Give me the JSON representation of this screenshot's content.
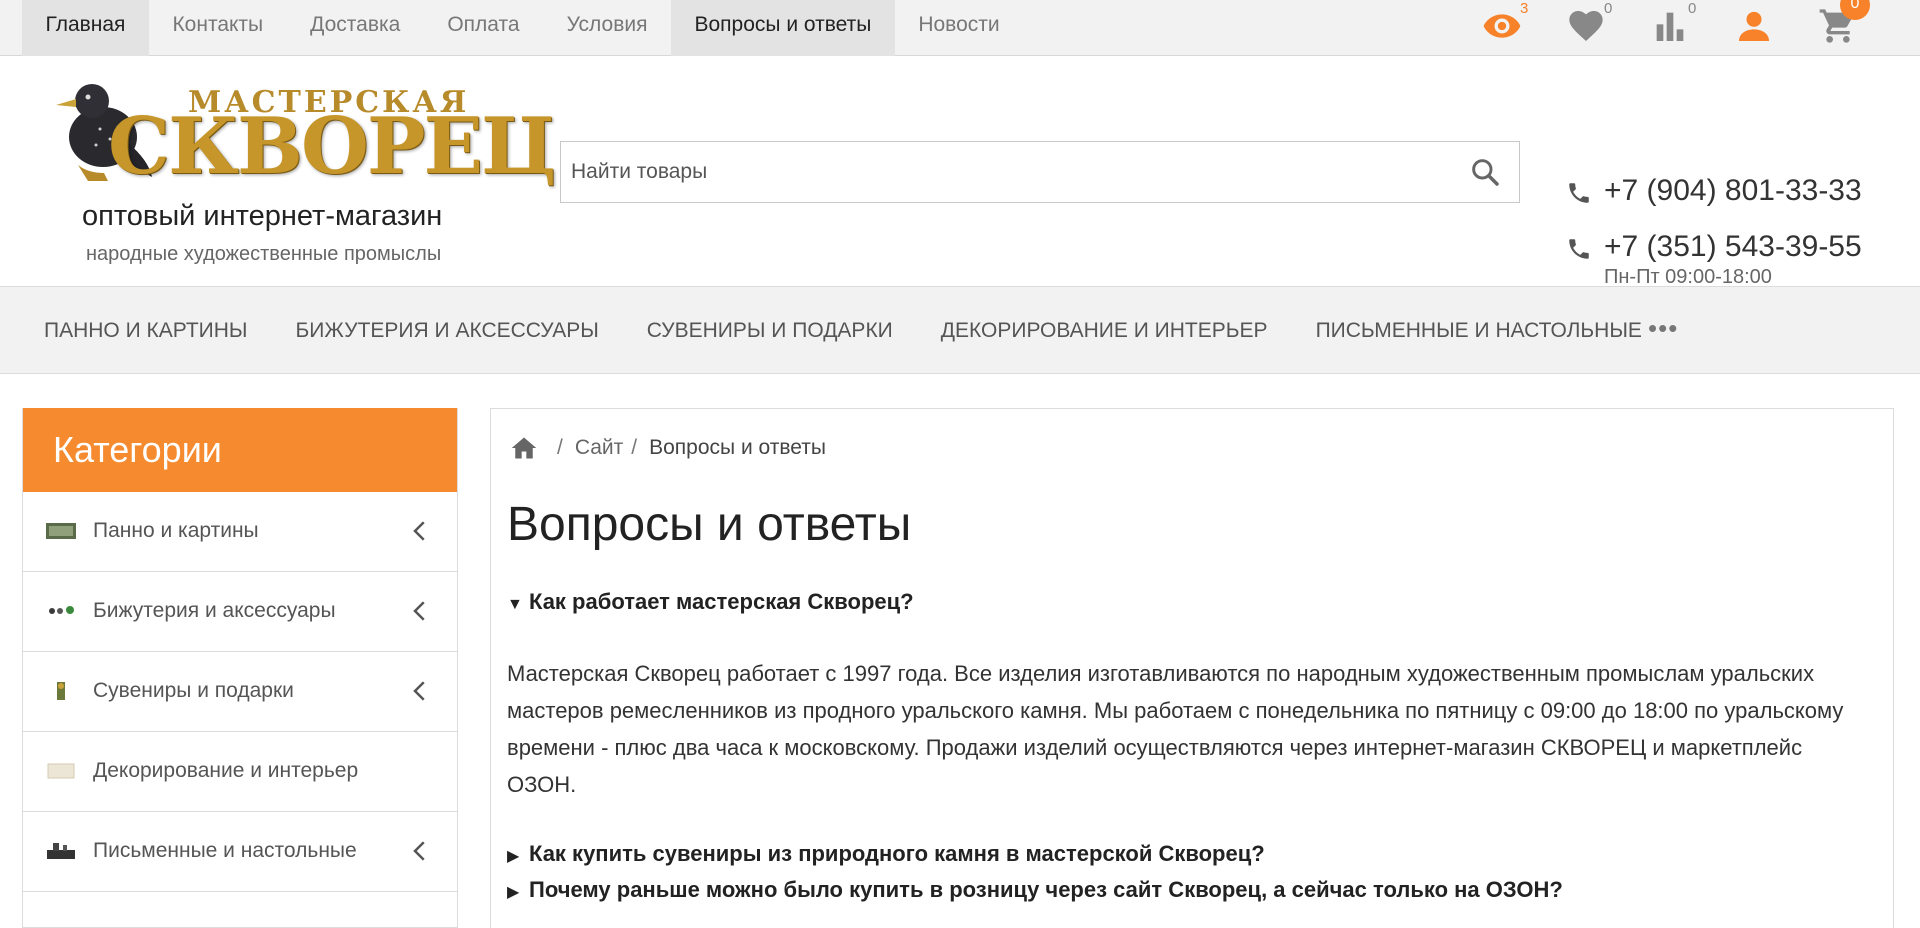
{
  "topbar": {
    "nav": [
      "Главная",
      "Контакты",
      "Доставка",
      "Оплата",
      "Условия",
      "Вопросы и ответы",
      "Новости"
    ],
    "counts": {
      "viewed": "3",
      "favorites": "0",
      "compare": "0",
      "cart": "0"
    }
  },
  "header": {
    "logo_top": "МАСТЕРСКАЯ",
    "logo_main": "СКВОРЕЦ",
    "tagline": "оптовый интернет-магазин",
    "subtagline": "народные художественные промыслы",
    "search_placeholder": "Найти товары",
    "phone1": "+7 (904) 801-33-33",
    "phone2": "+7 (351) 543-39-55",
    "hours": "Пн-Пт 09:00-18:00"
  },
  "catnav": [
    "ПАННО И КАРТИНЫ",
    "БИЖУТЕРИЯ И АКСЕССУАРЫ",
    "СУВЕНИРЫ И ПОДАРКИ",
    "ДЕКОРИРОВАНИЕ И ИНТЕРЬЕР",
    "ПИСЬМЕННЫЕ И НАСТОЛЬНЫЕ"
  ],
  "catnav_more": "•••",
  "sidebar": {
    "title": "Категории",
    "items": [
      "Панно и картины",
      "Бижутерия и аксессуары",
      "Сувениры и подарки",
      "Декорирование и интерьер",
      "Письменные и настольные"
    ]
  },
  "breadcrumb": {
    "sep": "/",
    "site": "Сайт",
    "current": "Вопросы и ответы"
  },
  "page": {
    "title": "Вопросы и ответы",
    "q1": "Как работает мастерская Скворец?",
    "a1": "Мастерская Скворец работает с 1997 года. Все изделия изготавливаются по народным художественным промыслам уральских мастеров ремесленников из продного уральского камня. Мы работаем с понедельника по пятницу с 09:00 до 18:00 по уральскому времени - плюс два часа к московскому. Продажи изделий осуществляются через интернет-магазин СКВОРЕЦ и маркетплейс ОЗОН.",
    "q2": "Как купить сувениры из природного камня в мастерской Скворец?",
    "q3": "Почему раньше можно было купить в розницу через сайт Скворец, а сейчас только на ОЗОН?",
    "open_marker": "▼",
    "closed_marker": "▶"
  },
  "colors": {
    "accent": "#f58a2e",
    "topbar_bg": "#f2f2f2"
  }
}
